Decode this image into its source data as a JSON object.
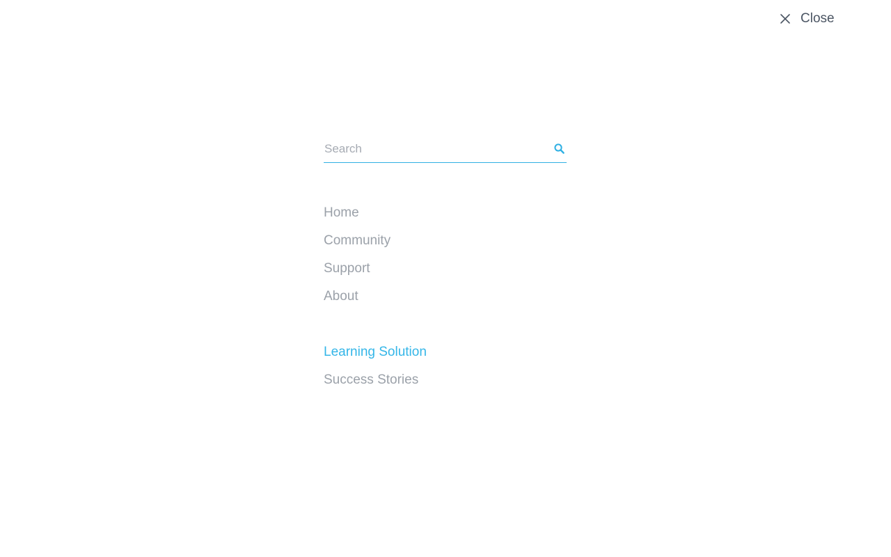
{
  "close": {
    "label": "Close",
    "icon": "close-icon"
  },
  "search": {
    "placeholder": "Search",
    "value": "",
    "icon": "search-icon",
    "accent_color": "#2fb0e3"
  },
  "nav_primary": [
    {
      "label": "Home"
    },
    {
      "label": "Community"
    },
    {
      "label": "Support"
    },
    {
      "label": "About"
    }
  ],
  "nav_secondary": [
    {
      "label": "Learning Solution",
      "active": true
    },
    {
      "label": "Success Stories",
      "active": false
    }
  ],
  "colors": {
    "text_muted": "#9ba1a9",
    "text_dark": "#4b5563",
    "accent": "#34b6e8",
    "background": "#ffffff"
  }
}
